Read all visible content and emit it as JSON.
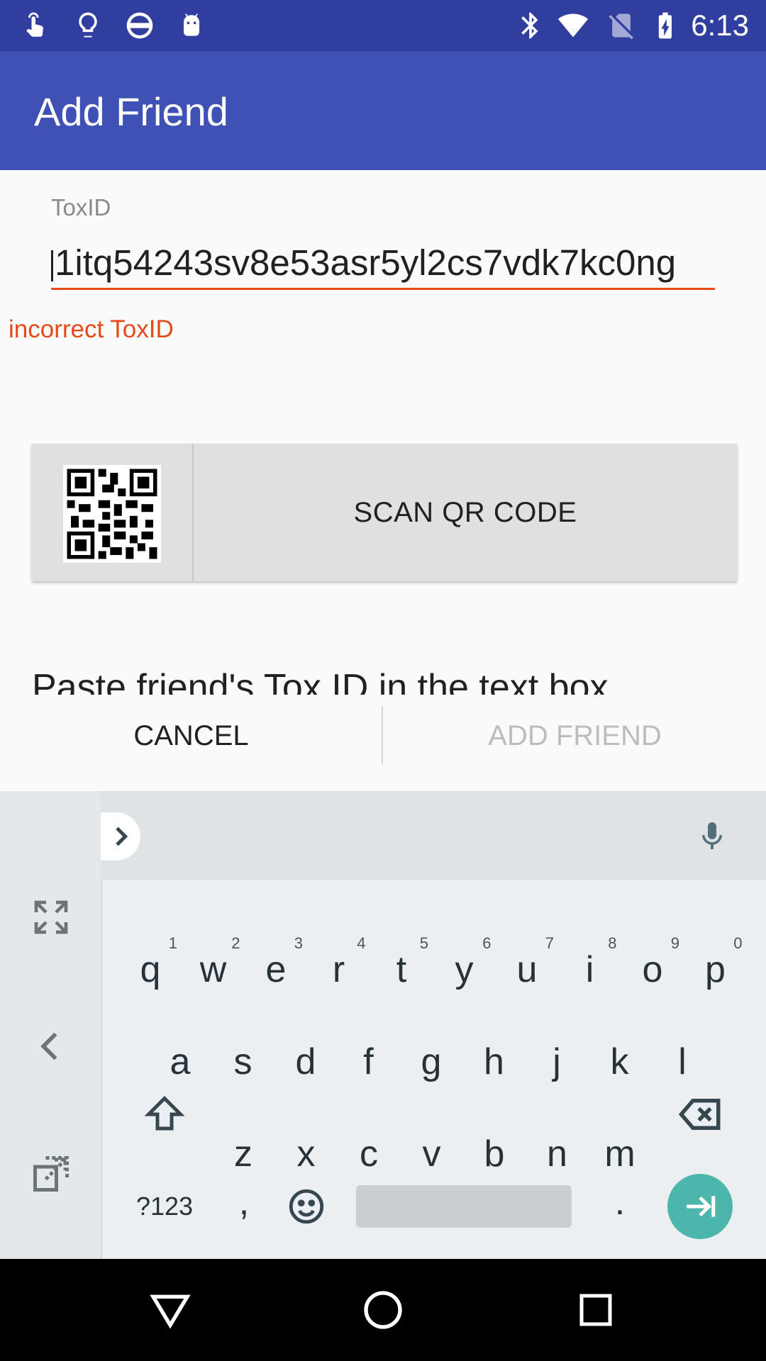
{
  "status_bar": {
    "time": "6:13",
    "left_icons": [
      "touch-icon",
      "lightbulb-icon",
      "do-not-disturb-icon",
      "android-icon"
    ],
    "right_icons": [
      "bluetooth-icon",
      "wifi-icon",
      "no-sim-icon",
      "battery-charging-icon"
    ]
  },
  "app_bar": {
    "title": "Add Friend",
    "color": "#3f51b5"
  },
  "form": {
    "label": "ToxID",
    "value": "1itq54243sv8e53asr5yl2cs7vdk7kc0ng",
    "error": "incorrect ToxID",
    "error_color": "#e64a19"
  },
  "scan_button": {
    "label": "SCAN QR CODE",
    "icon": "qr-code-icon"
  },
  "hint": "Paste friend's Tox ID in the text box",
  "dialog_actions": {
    "cancel": "CANCEL",
    "add": "ADD FRIEND"
  },
  "keyboard": {
    "row1": [
      {
        "key": "q",
        "num": "1"
      },
      {
        "key": "w",
        "num": "2"
      },
      {
        "key": "e",
        "num": "3"
      },
      {
        "key": "r",
        "num": "4"
      },
      {
        "key": "t",
        "num": "5"
      },
      {
        "key": "y",
        "num": "6"
      },
      {
        "key": "u",
        "num": "7"
      },
      {
        "key": "i",
        "num": "8"
      },
      {
        "key": "o",
        "num": "9"
      },
      {
        "key": "p",
        "num": "0"
      }
    ],
    "row2": [
      "a",
      "s",
      "d",
      "f",
      "g",
      "h",
      "j",
      "k",
      "l"
    ],
    "row3": [
      "z",
      "x",
      "c",
      "v",
      "b",
      "n",
      "m"
    ],
    "symbols_key": "?123",
    "comma_key": ",",
    "period_key": ".",
    "enter_color": "#4db6ac"
  }
}
